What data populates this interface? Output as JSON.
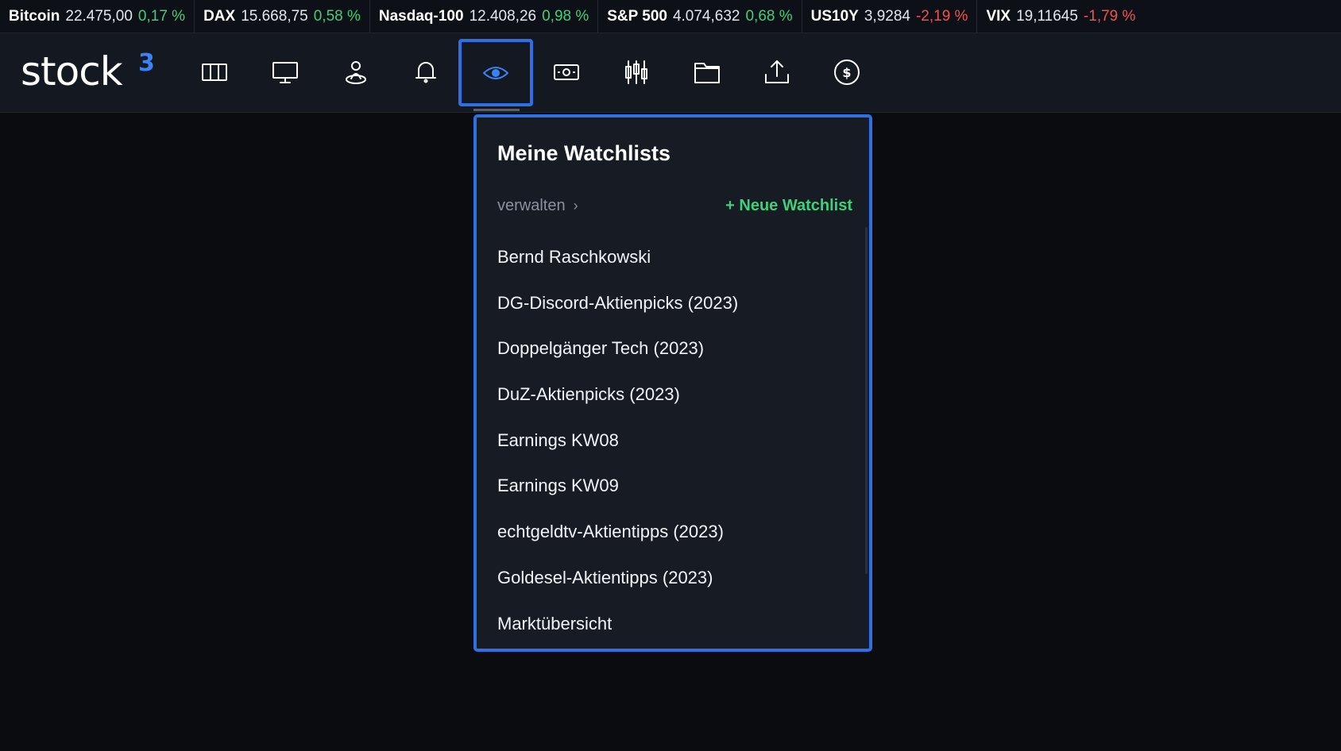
{
  "ticker": [
    {
      "name": "Bitcoin",
      "value": "22.475,00",
      "change": "0,17 %",
      "direction": "up"
    },
    {
      "name": "DAX",
      "value": "15.668,75",
      "change": "0,58 %",
      "direction": "up"
    },
    {
      "name": "Nasdaq-100",
      "value": "12.408,26",
      "change": "0,98 %",
      "direction": "up"
    },
    {
      "name": "S&P 500",
      "value": "4.074,632",
      "change": "0,68 %",
      "direction": "up"
    },
    {
      "name": "US10Y",
      "value": "3,9284",
      "change": "-2,19 %",
      "direction": "down"
    },
    {
      "name": "VIX",
      "value": "19,11645",
      "change": "-1,79 %",
      "direction": "down"
    }
  ],
  "logo": {
    "text": "stock",
    "superscript": "3"
  },
  "nav": {
    "icons": [
      "columns-icon",
      "monitor-icon",
      "user-pin-icon",
      "bell-icon",
      "eye-icon",
      "banknote-icon",
      "candlestick-icon",
      "folder-icon",
      "upload-icon",
      "dollar-coin-icon"
    ],
    "active": "eye-icon"
  },
  "dropdown": {
    "title": "Meine Watchlists",
    "manage_label": "verwalten",
    "new_label": "+ Neue Watchlist",
    "items": [
      "Bernd Raschkowski",
      "DG-Discord-Aktienpicks (2023)",
      "Doppelgänger Tech (2023)",
      "DuZ-Aktienpicks (2023)",
      "Earnings KW08",
      "Earnings KW09",
      "echtgeldtv-Aktientipps (2023)",
      "Goldesel-Aktientipps (2023)",
      "Marktübersicht"
    ]
  },
  "colors": {
    "accent": "#2f6fe4",
    "up": "#3fd17a",
    "down": "#f05252"
  }
}
